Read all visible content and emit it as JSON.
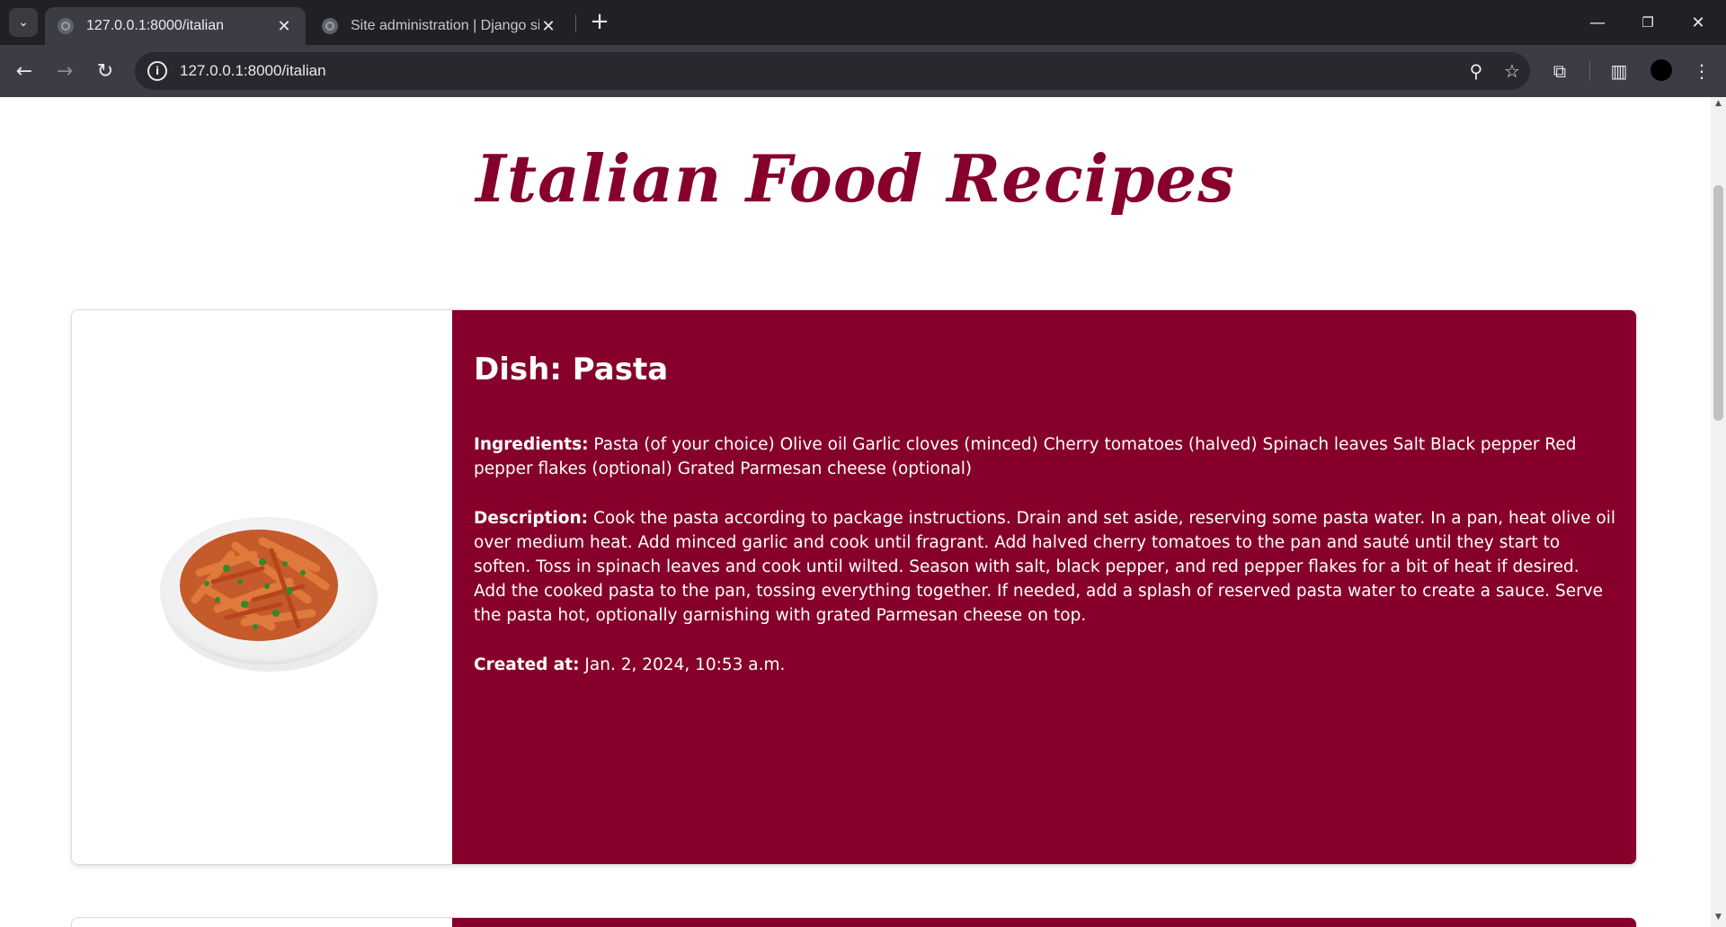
{
  "browser": {
    "tabs": [
      {
        "title": "127.0.0.1:8000/italian",
        "active": true
      },
      {
        "title": "Site administration | Django site",
        "active": false
      }
    ],
    "url": "127.0.0.1:8000/italian"
  },
  "page": {
    "title": "Italian Food Recipes",
    "recipes": [
      {
        "dish_label": "Dish:",
        "dish_name": "Pasta",
        "ingredients_label": "Ingredients:",
        "ingredients": "Pasta (of your choice) Olive oil Garlic cloves (minced) Cherry tomatoes (halved) Spinach leaves Salt Black pepper Red pepper flakes (optional) Grated Parmesan cheese (optional)",
        "description_label": "Description:",
        "description": "Cook the pasta according to package instructions. Drain and set aside, reserving some pasta water. In a pan, heat olive oil over medium heat. Add minced garlic and cook until fragrant. Add halved cherry tomatoes to the pan and sauté until they start to soften. Toss in spinach leaves and cook until wilted. Season with salt, black pepper, and red pepper flakes for a bit of heat if desired. Add the cooked pasta to the pan, tossing everything together. If needed, add a splash of reserved pasta water to create a sauce. Serve the pasta hot, optionally garnishing with grated Parmesan cheese on top.",
        "created_label": "Created at:",
        "created": "Jan. 2, 2024, 10:53 a.m."
      }
    ]
  },
  "colors": {
    "accent": "#86002b",
    "chrome_dark": "#202124",
    "toolbar": "#3c3c44"
  }
}
